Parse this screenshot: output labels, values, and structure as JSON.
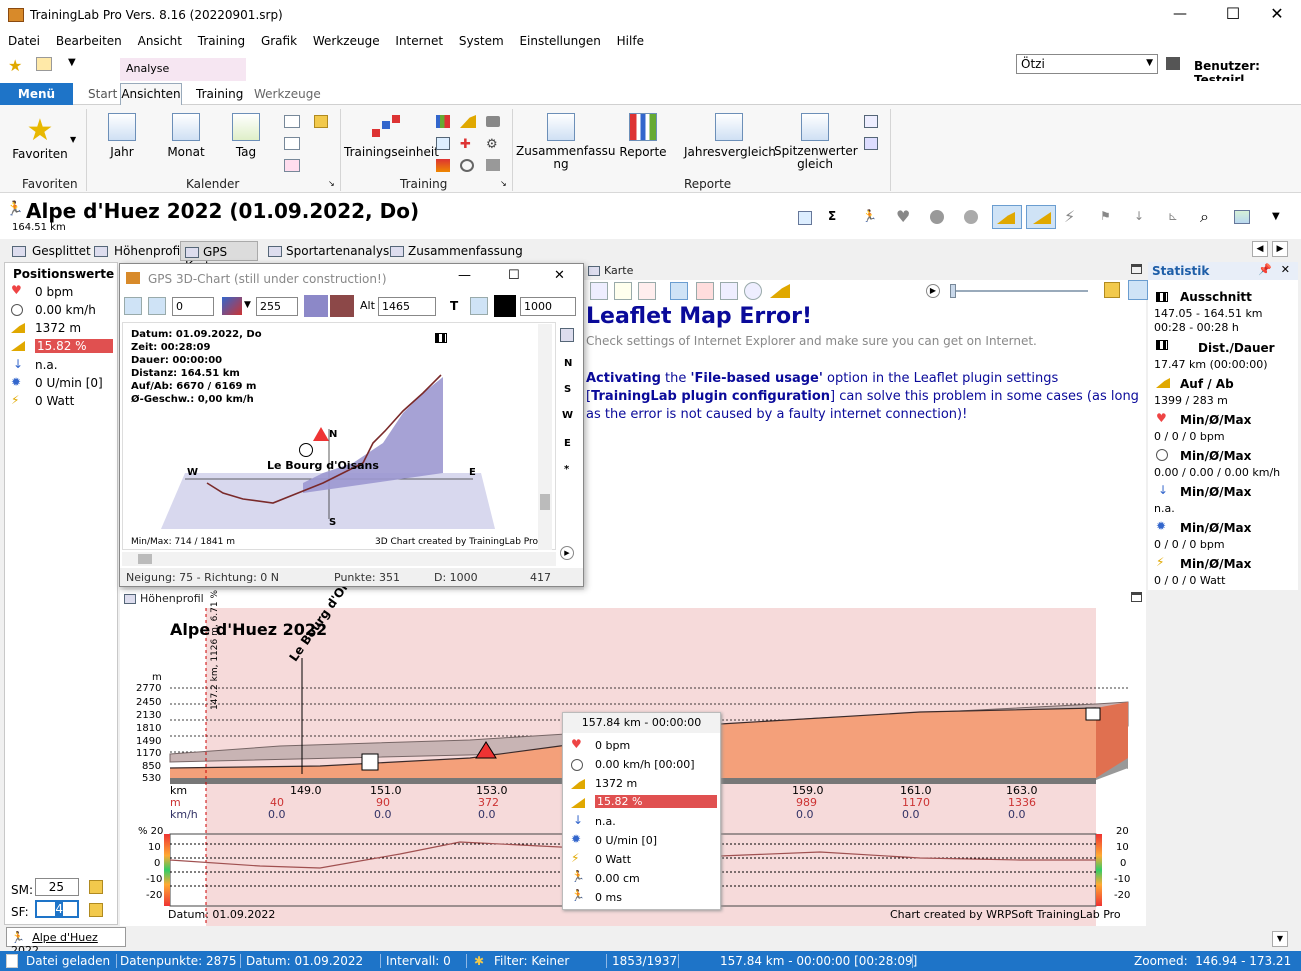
{
  "app": {
    "title": "TrainingLab Pro Vers. 8.16 (20220901.srp)"
  },
  "menu": [
    "Datei",
    "Bearbeiten",
    "Ansicht",
    "Training",
    "Grafik",
    "Werkzeuge",
    "Internet",
    "System",
    "Einstellungen",
    "Hilfe"
  ],
  "quick": {
    "user_select": "Ötzi",
    "user_label": "Benutzer: Testgirl"
  },
  "ribbon_tabs": {
    "menu": "Menü",
    "start": "Start",
    "ansichten": "Ansichten",
    "training": "Training",
    "werkzeuge": "Werkzeuge",
    "context": "Analyse"
  },
  "ribbon": {
    "favoriten": "Favoriten",
    "favoriten_group": "Favoriten",
    "jahr": "Jahr",
    "monat": "Monat",
    "tag": "Tag",
    "kalender_group": "Kalender",
    "trainingseinheit": "Trainingseinheit",
    "training_group": "Training",
    "zusammenfassung": "Zusammenfassu\nng",
    "reporte": "Reporte",
    "jahresvergleich": "Jahresvergleich",
    "spitzenwerte": "Spitzenwerter\ngleich",
    "reporte_group": "Reporte"
  },
  "header": {
    "title": "Alpe d'Huez 2022 (01.09.2022, Do)",
    "distance": "164.51 km"
  },
  "view_tabs": [
    "Gesplittet",
    "Höhenprofil",
    "GPS Karte",
    "Sportartenanalyse",
    "Zusammenfassung"
  ],
  "position": {
    "title": "Positionswerte",
    "hr": "0 bpm",
    "speed": "0.00 km/h",
    "alt": "1372 m",
    "grade": "15.82 %",
    "na": "n.a.",
    "cadence": "0 U/min [0]",
    "power": "0 Watt",
    "sm_label": "SM:",
    "sm_value": "25",
    "sf_label": "SF:",
    "sf_value": "4"
  },
  "gps3d": {
    "title": "GPS 3D-Chart (still under construction!)",
    "tilt": "0",
    "color_val": "255",
    "alt_label": "Alt",
    "alt_value": "1465",
    "t_label": "T",
    "dist_value": "1000",
    "info": [
      "Datum: 01.09.2022, Do",
      "Zeit: 00:28:09",
      "Dauer: 00:00:00",
      "Distanz: 164.51 km",
      "Auf/Ab: 6670 / 6169 m",
      "Ø-Geschw.: 0,00 km/h"
    ],
    "place": "Le Bourg d'Oisans",
    "compass": {
      "n": "N",
      "s": "S",
      "w": "W",
      "e": "E"
    },
    "side": [
      "N",
      "S",
      "W",
      "E",
      "*"
    ],
    "minmax": "Min/Max: 714 / 1841 m",
    "credit": "3D Chart created by TrainingLab Pro",
    "status": {
      "tilt": "Neigung: 75 - Richtung: 0 N",
      "points": "Punkte: 351",
      "d": "D: 1000",
      "n": "417"
    }
  },
  "karte": {
    "title": "Karte",
    "error_title": "Leaflet Map Error!",
    "error_sub": "Check settings of Internet Explorer and make sure you can get on Internet.",
    "error_p1": "Activating",
    "error_p2": " the ",
    "error_p3": "'File-based usage'",
    "error_p4": " option in the Leaflet plugin settings [",
    "error_p5": "TrainingLab plugin configuration",
    "error_p6": "] can solve this problem in some cases (as long as the error is not caused by a faulty internet connection)!"
  },
  "statistik": {
    "title": "Statistik",
    "ausschnitt": "Ausschnitt",
    "ausschnitt_v1": "147.05 - 164.51 km",
    "ausschnitt_v2": "00:28 - 00:28 h",
    "distdauer": "Dist./Dauer",
    "distdauer_v": "17.47 km (00:00:00)",
    "aufab": "Auf / Ab",
    "aufab_v": "1399 / 283 m",
    "hr_h": "Min/Ø/Max",
    "hr_v": "0 / 0 / 0 bpm",
    "sp_h": "Min/Ø/Max",
    "sp_v": "0.00 / 0.00 / 0.00 km/h",
    "na_h": "Min/Ø/Max",
    "na_v": "n.a.",
    "cad_h": "Min/Ø/Max",
    "cad_v": "0 / 0 / 0 bpm",
    "pw_h": "Min/Ø/Max",
    "pw_v": "0 / 0 / 0 Watt"
  },
  "profile": {
    "title": "Höhenprofil",
    "chart_title": "Alpe d'Huez 2022",
    "place": "Le Bourg d'Oisans",
    "vlabel": "147.2 km, 1126 m, 6.71 %",
    "y_unit": "m",
    "y_ticks": [
      "2770",
      "2450",
      "2130",
      "1810",
      "1490",
      "1170",
      "850",
      "530"
    ],
    "row_labels": [
      "km",
      "m",
      "km/h"
    ],
    "km": [
      "149.0",
      "151.0",
      "153.0",
      "159.0",
      "161.0",
      "163.0"
    ],
    "m": [
      "40",
      "90",
      "372",
      "989",
      "1170",
      "1336"
    ],
    "kmh": [
      "0.0",
      "0.0",
      "0.0",
      "0.0",
      "0.0",
      "0.0"
    ],
    "grade_unit": "% 20",
    "grade_ticks": [
      "10",
      "0",
      "-10",
      "-20"
    ],
    "grade_right": [
      "20",
      "10",
      "0",
      "-10",
      "-20"
    ],
    "date": "Datum: 01.09.2022",
    "credit": "Chart created by WRPSoft TrainingLab Pro"
  },
  "tooltip": {
    "header": "157.84 km - 00:00:00",
    "rows": [
      "0 bpm",
      "0.00 km/h [00:00]",
      "1372 m",
      "15.82 %",
      "n.a.",
      "0 U/min [0]",
      "0 Watt",
      "0.00 cm",
      "0 ms"
    ]
  },
  "doc_tab": "Alpe d'Huez 2022",
  "status": {
    "loaded": "Datei geladen",
    "points": "Datenpunkte: 2875",
    "date": "Datum: 01.09.2022",
    "interval": "Intervall: 0",
    "filter": "Filter: Keiner",
    "count": "1853/1937",
    "pos": "157.84 km - 00:00:00 [00:28:09]",
    "zoom": "Zoomed:  146.94 - 173.21"
  },
  "colors": {
    "accent": "#1e74c8",
    "grade_highlight": "#e05050",
    "profile_fill": "#f4a07a",
    "profile_bg": "#f6dada",
    "error_blue": "#0a0a9a"
  }
}
